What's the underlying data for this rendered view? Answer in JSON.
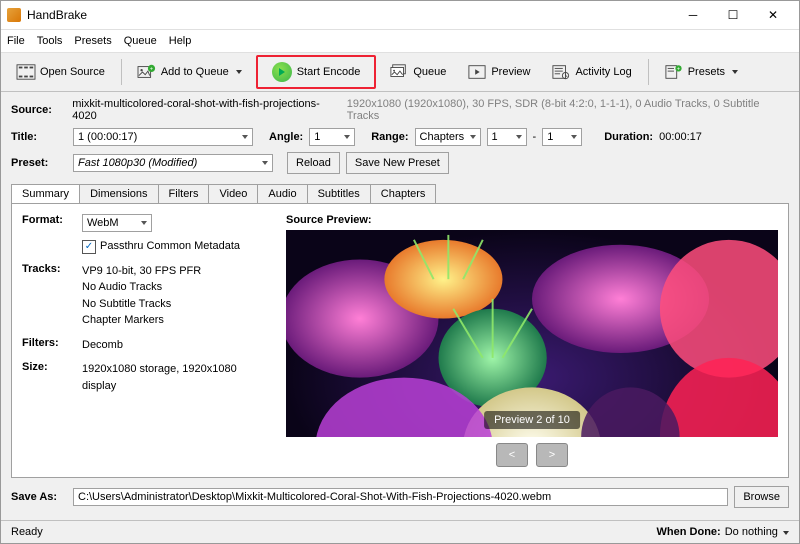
{
  "window": {
    "title": "HandBrake"
  },
  "menu": {
    "file": "File",
    "tools": "Tools",
    "presets": "Presets",
    "queue": "Queue",
    "help": "Help"
  },
  "toolbar": {
    "open": "Open Source",
    "add": "Add to Queue",
    "start": "Start Encode",
    "queue": "Queue",
    "preview": "Preview",
    "log": "Activity Log",
    "presets": "Presets"
  },
  "source": {
    "label": "Source:",
    "file": "mixkit-multicolored-coral-shot-with-fish-projections-4020",
    "info": "1920x1080 (1920x1080), 30 FPS, SDR (8-bit 4:2:0, 1-1-1), 0 Audio Tracks, 0 Subtitle Tracks"
  },
  "title": {
    "label": "Title:",
    "value": "1  (00:00:17)",
    "angle_label": "Angle:",
    "angle": "1",
    "range_label": "Range:",
    "range_type": "Chapters",
    "from": "1",
    "dash": "-",
    "to": "1",
    "duration_label": "Duration:",
    "duration": "00:00:17"
  },
  "preset": {
    "label": "Preset:",
    "value": "Fast 1080p30  (Modified)",
    "reload": "Reload",
    "save": "Save New Preset"
  },
  "tabs": [
    "Summary",
    "Dimensions",
    "Filters",
    "Video",
    "Audio",
    "Subtitles",
    "Chapters"
  ],
  "summary": {
    "format_label": "Format:",
    "format": "WebM",
    "passthru": "Passthru Common Metadata",
    "tracks_label": "Tracks:",
    "tracks": [
      "VP9 10-bit, 30 FPS PFR",
      "No Audio Tracks",
      "No Subtitle Tracks",
      "Chapter Markers"
    ],
    "filters_label": "Filters:",
    "filters": "Decomb",
    "size_label": "Size:",
    "size": "1920x1080 storage, 1920x1080 display",
    "preview_label": "Source Preview:",
    "preview_count": "Preview 2 of 10"
  },
  "saveas": {
    "label": "Save As:",
    "path": "C:\\Users\\Administrator\\Desktop\\Mixkit-Multicolored-Coral-Shot-With-Fish-Projections-4020.webm",
    "browse": "Browse"
  },
  "status": {
    "ready": "Ready",
    "whendone_label": "When Done:",
    "whendone": "Do nothing"
  }
}
